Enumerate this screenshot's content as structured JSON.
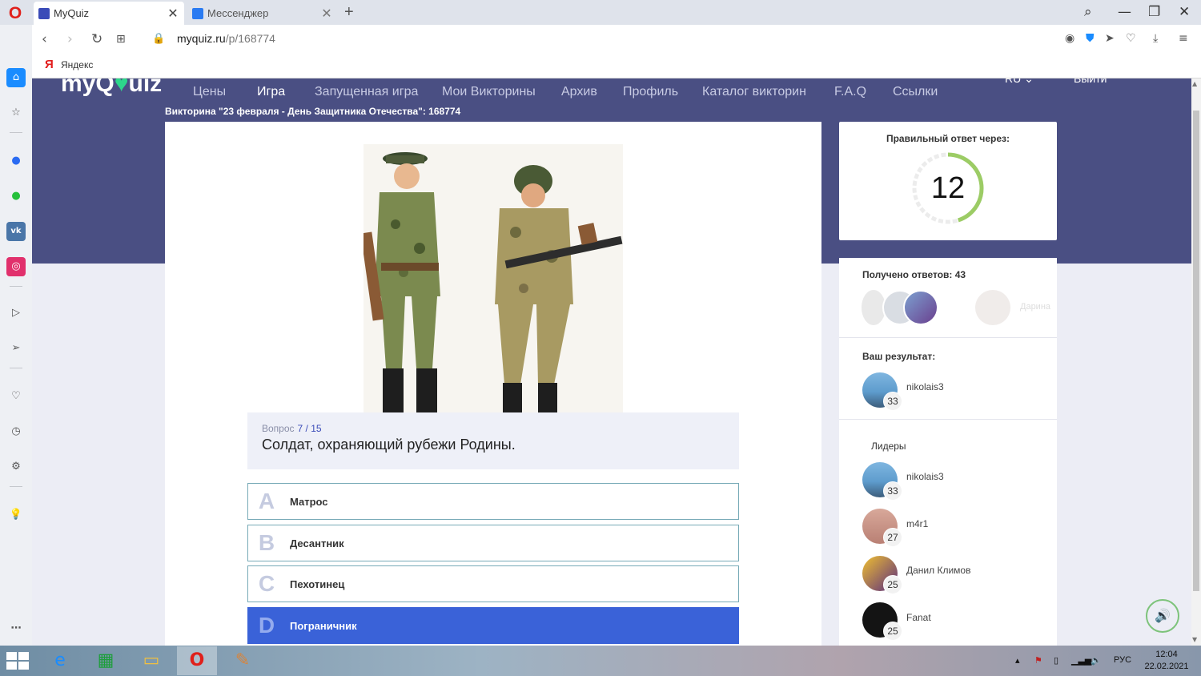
{
  "browser": {
    "tabs": [
      {
        "label": "MyQuiz",
        "active": true
      },
      {
        "label": "Мессенджер",
        "active": false
      }
    ],
    "url_host": "myquiz.ru",
    "url_path": "/p/168774",
    "bookmark": "Яндекс"
  },
  "site": {
    "logo_parts": [
      "myQ",
      "♥",
      "uiz"
    ],
    "nav": [
      "Цены",
      "Игра",
      "Запущенная игра",
      "Мои Викторины",
      "Архив",
      "Профиль",
      "Каталог викторин",
      "F.A.Q",
      "Ссылки"
    ],
    "nav_active": "Игра",
    "lang": "RU",
    "logout": "Выйти",
    "quiz_title": "Викторина \"23 февраля - День Защитника Отечества\": 168774"
  },
  "question": {
    "label": "Вопрос",
    "number": "7 / 15",
    "text": "Солдат, охраняющий рубежи Родины.",
    "answers": [
      {
        "letter": "A",
        "text": "Матрос",
        "selected": false
      },
      {
        "letter": "B",
        "text": "Десантник",
        "selected": false
      },
      {
        "letter": "C",
        "text": "Пехотинец",
        "selected": false
      },
      {
        "letter": "D",
        "text": "Пограничник",
        "selected": true
      }
    ]
  },
  "timer": {
    "title": "Правильный ответ через:",
    "value": "12",
    "ring_fraction": 0.45,
    "ring_color": "#9ccc65"
  },
  "sidebar": {
    "answers_title": "Получено ответов: 43",
    "answers_faded_name": "Дарина",
    "result_title": "Ваш результат:",
    "result": {
      "name": "nikolais3",
      "score": "33"
    },
    "leaders_title": "Лидеры",
    "leaders": [
      {
        "name": "nikolais3",
        "score": "33"
      },
      {
        "name": "m4r1",
        "score": "27"
      },
      {
        "name": "Данил Климов",
        "score": "25"
      },
      {
        "name": "Fanat",
        "score": "25"
      }
    ]
  },
  "taskbar": {
    "lang": "РУС",
    "time": "12:04",
    "date": "22.02.2021"
  },
  "colors": {
    "hero": "#4a4f83",
    "selected_answer": "#3a62d8",
    "accent_green": "#7dc37a"
  }
}
